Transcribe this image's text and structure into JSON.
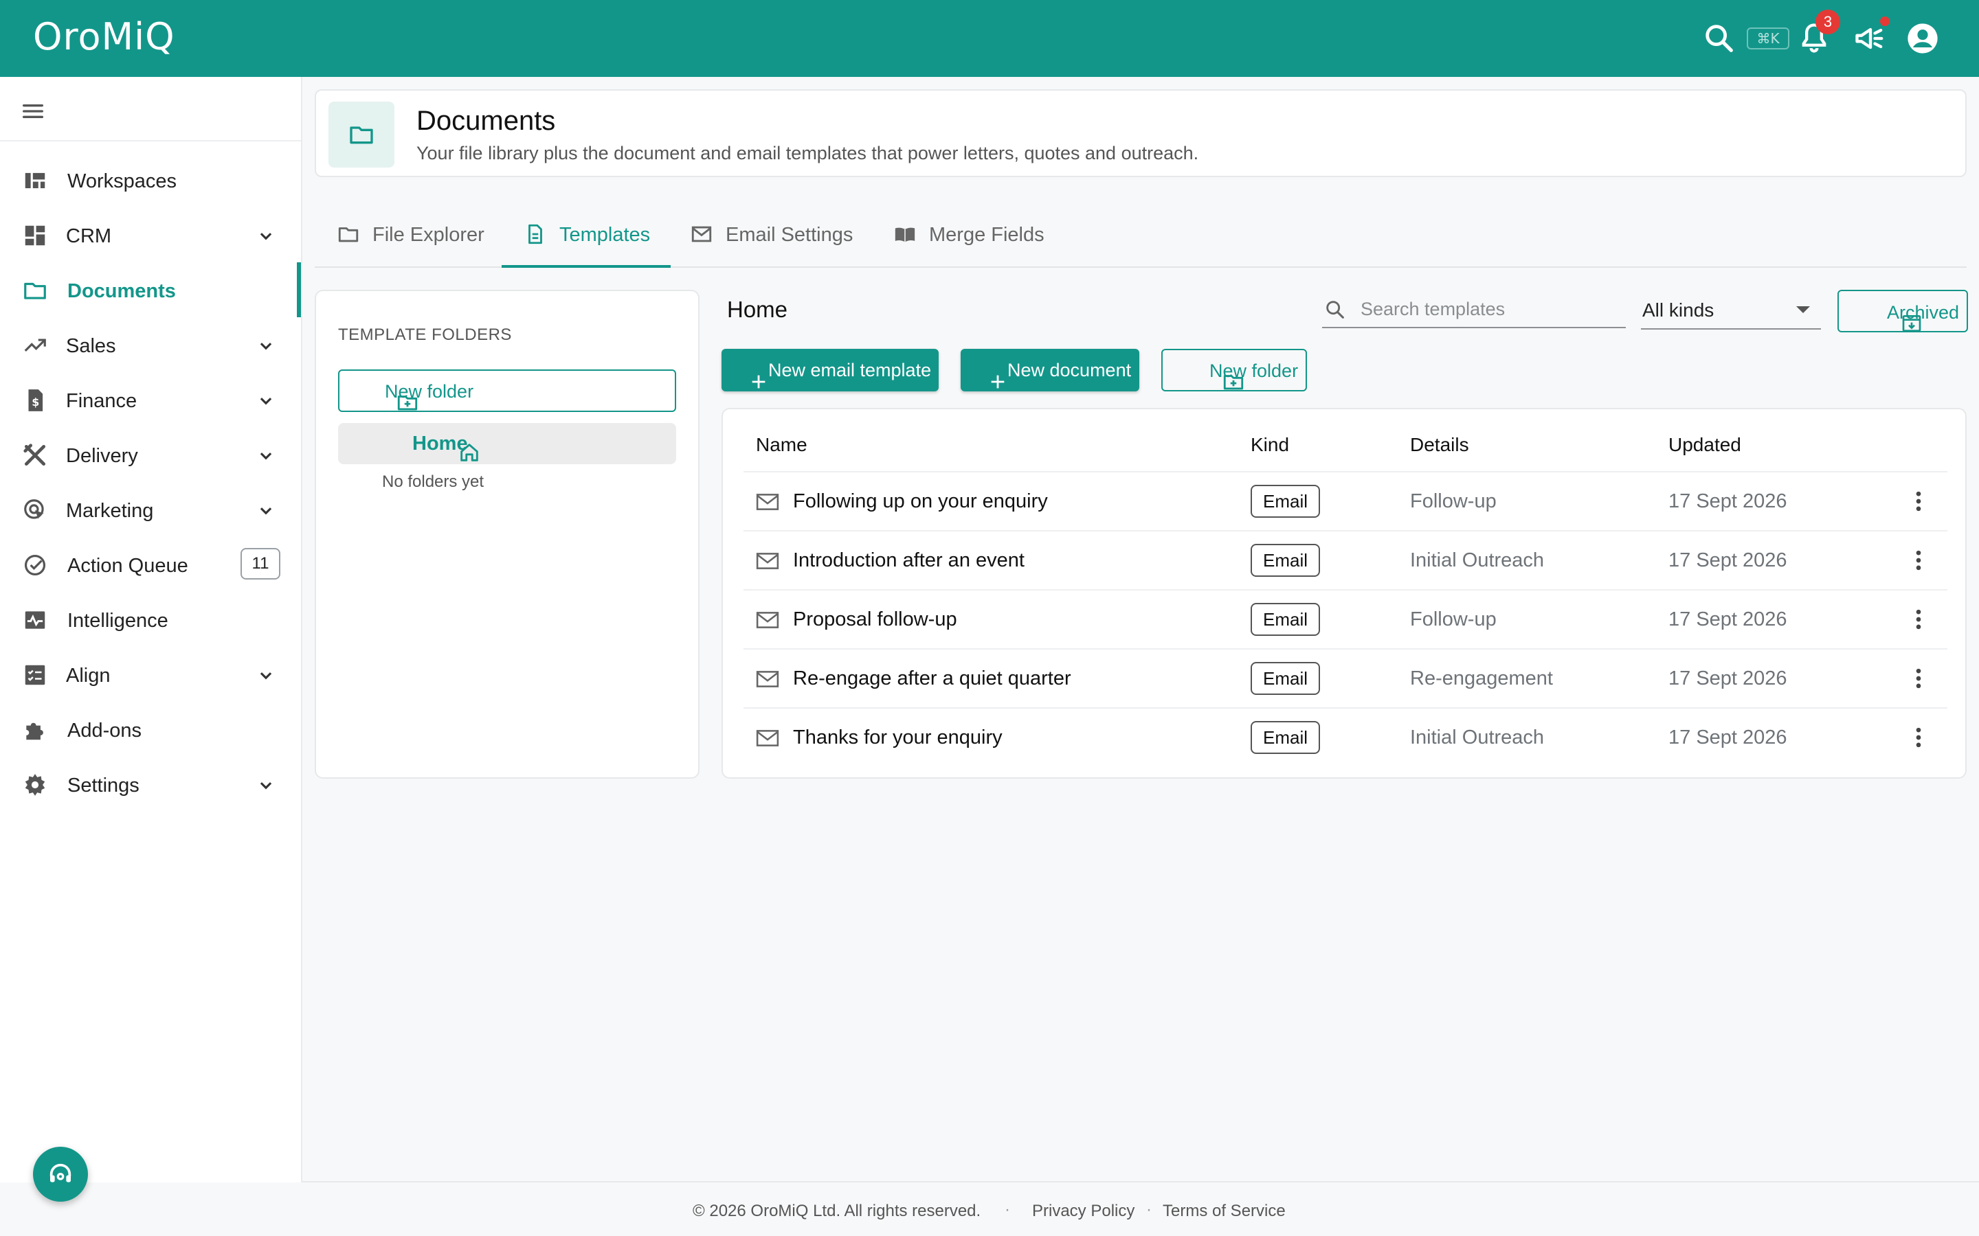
{
  "app": {
    "logo": "OroMiQ",
    "shortcut_hint": "⌘K",
    "notification_count": "3"
  },
  "brand_color": "#13968a",
  "sidebar": {
    "items": [
      {
        "label": "Workspaces",
        "icon": "workspaces-icon",
        "expandable": false
      },
      {
        "label": "CRM",
        "icon": "dashboard-grid-icon",
        "expandable": true
      },
      {
        "label": "Documents",
        "icon": "folder-icon",
        "expandable": false,
        "active": true
      },
      {
        "label": "Sales",
        "icon": "trending-up-icon",
        "expandable": true
      },
      {
        "label": "Finance",
        "icon": "invoice-dollar-icon",
        "expandable": true
      },
      {
        "label": "Delivery",
        "icon": "tools-icon",
        "expandable": true
      },
      {
        "label": "Marketing",
        "icon": "target-pointer-icon",
        "expandable": true
      },
      {
        "label": "Action Queue",
        "icon": "check-circle-icon",
        "expandable": false,
        "badge": "11"
      },
      {
        "label": "Intelligence",
        "icon": "pulse-chart-icon",
        "expandable": false
      },
      {
        "label": "Align",
        "icon": "checklist-icon",
        "expandable": true
      },
      {
        "label": "Add-ons",
        "icon": "puzzle-icon",
        "expandable": false
      },
      {
        "label": "Settings",
        "icon": "gear-icon",
        "expandable": true
      }
    ]
  },
  "header": {
    "title": "Documents",
    "subtitle": "Your file library plus the document and email templates that power letters, quotes and outreach."
  },
  "tabs": [
    {
      "label": "File Explorer",
      "icon": "folder-icon"
    },
    {
      "label": "Templates",
      "icon": "document-icon",
      "active": true
    },
    {
      "label": "Email Settings",
      "icon": "mail-icon"
    },
    {
      "label": "Merge Fields",
      "icon": "book-icon"
    }
  ],
  "folders": {
    "title": "TEMPLATE FOLDERS",
    "new_folder_label": "New folder",
    "home_label": "Home",
    "empty_text": "No folders yet"
  },
  "main": {
    "breadcrumb": "Home",
    "search_placeholder": "Search templates",
    "kind_filter": "All kinds",
    "archived_label": "Archived",
    "buttons": {
      "new_email_template": "New email template",
      "new_document": "New document",
      "new_folder": "New folder"
    }
  },
  "table": {
    "columns": [
      "Name",
      "Kind",
      "Details",
      "Updated"
    ],
    "rows": [
      {
        "name": "Following up on your enquiry",
        "kind": "Email",
        "details": "Follow-up",
        "updated": "17 Sept 2026"
      },
      {
        "name": "Introduction after an event",
        "kind": "Email",
        "details": "Initial Outreach",
        "updated": "17 Sept 2026"
      },
      {
        "name": "Proposal follow-up",
        "kind": "Email",
        "details": "Follow-up",
        "updated": "17 Sept 2026"
      },
      {
        "name": "Re-engage after a quiet quarter",
        "kind": "Email",
        "details": "Re-engagement",
        "updated": "17 Sept 2026"
      },
      {
        "name": "Thanks for your enquiry",
        "kind": "Email",
        "details": "Initial Outreach",
        "updated": "17 Sept 2026"
      }
    ]
  },
  "footer": {
    "copyright": "© 2026 OroMiQ Ltd. All rights reserved.",
    "privacy": "Privacy Policy",
    "terms": "Terms of Service"
  }
}
